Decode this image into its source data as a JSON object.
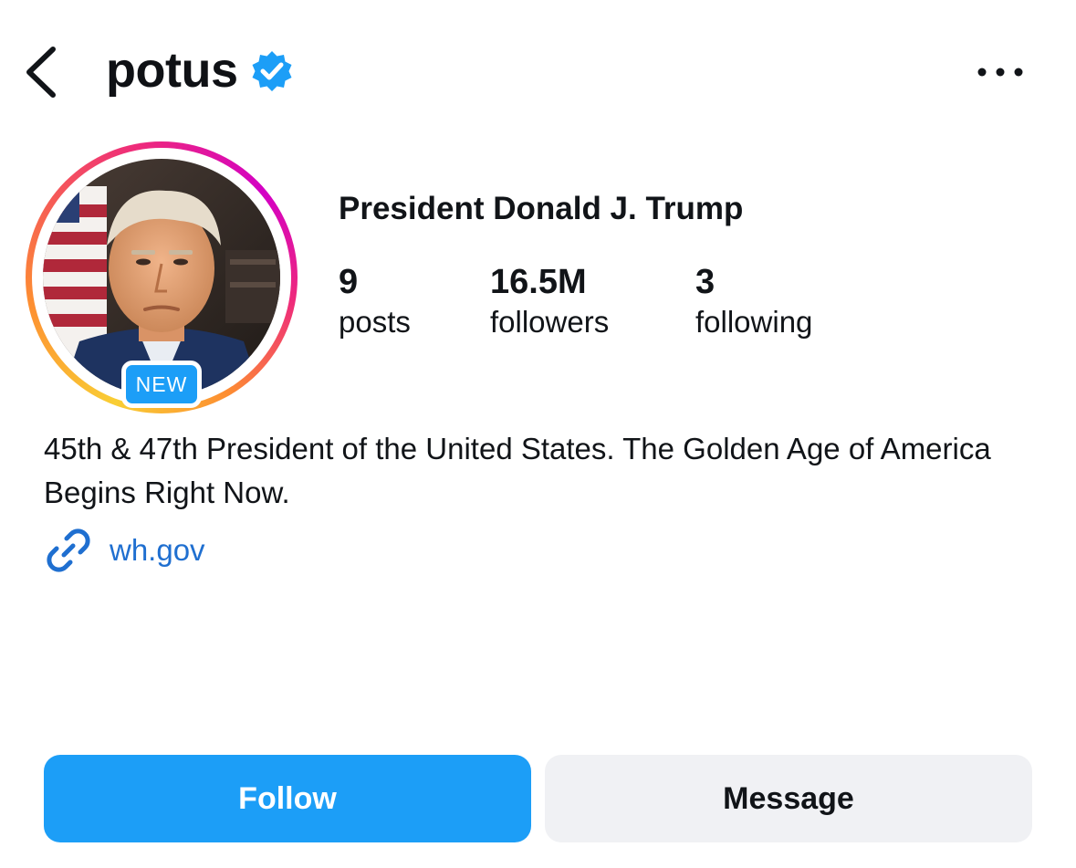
{
  "header": {
    "username": "potus",
    "back_icon": "chevron-left-icon",
    "verified_icon": "verified-badge-icon",
    "more_icon": "more-horizontal-icon"
  },
  "profile": {
    "display_name": "President Donald J. Trump",
    "avatar_badge": "NEW",
    "stats": [
      {
        "value": "9",
        "label": "posts"
      },
      {
        "value": "16.5M",
        "label": "followers"
      },
      {
        "value": "3",
        "label": "following"
      }
    ],
    "bio": "45th & 47th President of the United States. The Golden Age of America Begins Right Now.",
    "link": {
      "icon": "link-icon",
      "text": "wh.gov"
    }
  },
  "actions": {
    "follow_label": "Follow",
    "message_label": "Message"
  },
  "colors": {
    "accent": "#1c9ef7",
    "link": "#1f6fd0",
    "secondary_button": "#f0f1f4",
    "text": "#111418"
  }
}
